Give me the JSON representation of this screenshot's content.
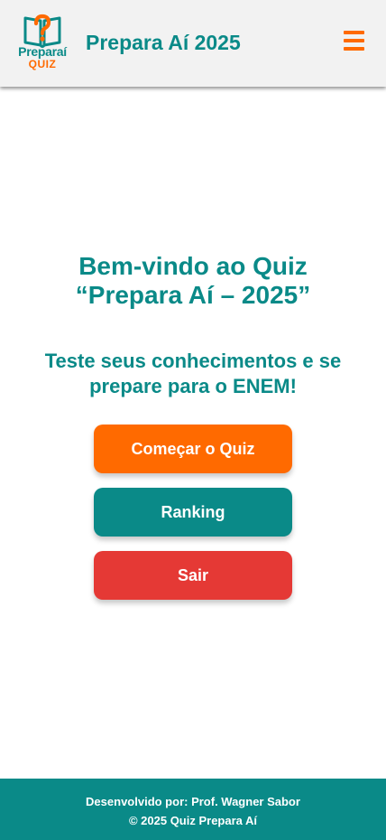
{
  "header": {
    "logo": {
      "brand": "Preparaí",
      "sub": "QUIZ",
      "icon": "book-question-icon"
    },
    "title": "Prepara Aí 2025",
    "menu_icon": "hamburger-menu-icon"
  },
  "hero": {
    "welcome_line1": "Bem-vindo ao Quiz",
    "welcome_line2": "“Prepara Aí – 2025”",
    "tagline": "Teste seus conhecimentos e se prepare para o ENEM!"
  },
  "buttons": {
    "start": "Começar o Quiz",
    "ranking": "Ranking",
    "exit": "Sair"
  },
  "footer": {
    "credit": "Desenvolvido por: Prof. Wagner Sabor",
    "copyright": "© 2025 Quiz Prepara Aí"
  },
  "colors": {
    "teal": "#0a8a88",
    "orange": "#ff6a00",
    "red": "#e53935",
    "header_bg": "#f2f2f2"
  }
}
